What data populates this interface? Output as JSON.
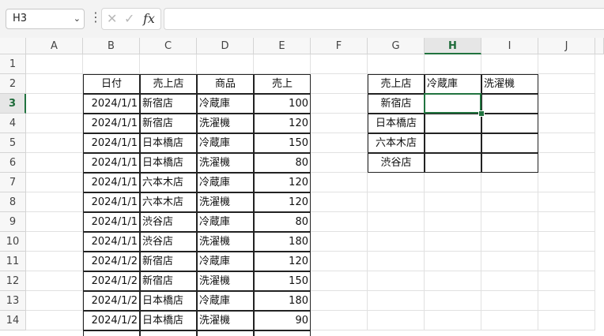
{
  "name_box": {
    "value": "H3"
  },
  "formula_bar": {
    "cancel_glyph": "✕",
    "enter_glyph": "✓",
    "fx_glyph": "fx",
    "content": ""
  },
  "columns": [
    "A",
    "B",
    "C",
    "D",
    "E",
    "F",
    "G",
    "H",
    "I",
    "J"
  ],
  "rows": [
    "1",
    "2",
    "3",
    "4",
    "5",
    "6",
    "7",
    "8",
    "9",
    "10",
    "11",
    "12",
    "13",
    "14"
  ],
  "selected": {
    "column": "H",
    "row": "3"
  },
  "table1": {
    "headers": [
      "日付",
      "売上店",
      "商品",
      "売上"
    ],
    "rows": [
      [
        "2024/1/1",
        "新宿店",
        "冷蔵庫",
        "100"
      ],
      [
        "2024/1/1",
        "新宿店",
        "洗濯機",
        "120"
      ],
      [
        "2024/1/1",
        "日本橋店",
        "冷蔵庫",
        "150"
      ],
      [
        "2024/1/1",
        "日本橋店",
        "洗濯機",
        "80"
      ],
      [
        "2024/1/1",
        "六本木店",
        "冷蔵庫",
        "120"
      ],
      [
        "2024/1/1",
        "六本木店",
        "洗濯機",
        "120"
      ],
      [
        "2024/1/1",
        "渋谷店",
        "冷蔵庫",
        "80"
      ],
      [
        "2024/1/1",
        "渋谷店",
        "洗濯機",
        "180"
      ],
      [
        "2024/1/2",
        "新宿店",
        "冷蔵庫",
        "120"
      ],
      [
        "2024/1/2",
        "新宿店",
        "洗濯機",
        "150"
      ],
      [
        "2024/1/2",
        "日本橋店",
        "冷蔵庫",
        "180"
      ],
      [
        "2024/1/2",
        "日本橋店",
        "洗濯機",
        "90"
      ]
    ]
  },
  "table2": {
    "headers": [
      "売上店",
      "冷蔵庫",
      "洗濯機"
    ],
    "rows": [
      [
        "新宿店",
        "",
        ""
      ],
      [
        "日本橋店",
        "",
        ""
      ],
      [
        "六本木店",
        "",
        ""
      ],
      [
        "渋谷店",
        "",
        ""
      ]
    ]
  },
  "colors": {
    "accent": "#21733f",
    "header_bg": "#f7f7f7",
    "gridline": "#e1e1e1"
  }
}
